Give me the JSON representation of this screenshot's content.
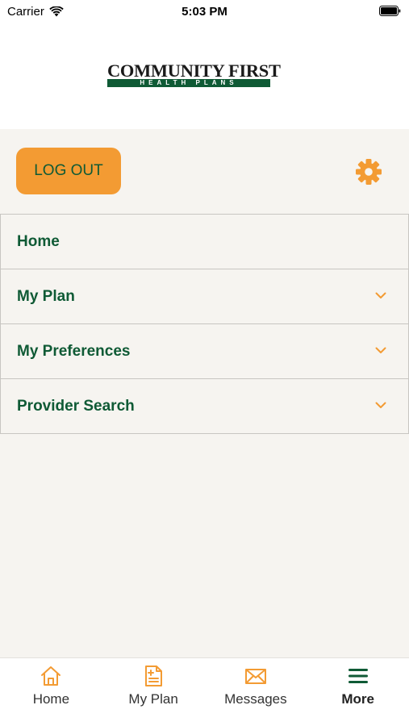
{
  "status_bar": {
    "carrier": "Carrier",
    "time": "5:03 PM"
  },
  "logo": {
    "line1": "COMMUNITY FIRST",
    "line2": "HEALTH PLANS"
  },
  "actions": {
    "logout_label": "LOG OUT",
    "settings_icon": "gear-icon"
  },
  "menu": {
    "items": [
      {
        "label": "Home",
        "expandable": false
      },
      {
        "label": "My Plan",
        "expandable": true
      },
      {
        "label": "My Preferences",
        "expandable": true
      },
      {
        "label": "Provider Search",
        "expandable": true
      }
    ]
  },
  "tabbar": {
    "items": [
      {
        "label": "Home",
        "icon": "home-icon",
        "active": false
      },
      {
        "label": "My Plan",
        "icon": "document-icon",
        "active": false
      },
      {
        "label": "Messages",
        "icon": "envelope-icon",
        "active": false
      },
      {
        "label": "More",
        "icon": "hamburger-icon",
        "active": true
      }
    ]
  },
  "colors": {
    "brand_green": "#0f5a35",
    "accent_orange": "#f39b33",
    "background": "#f6f4f0"
  }
}
